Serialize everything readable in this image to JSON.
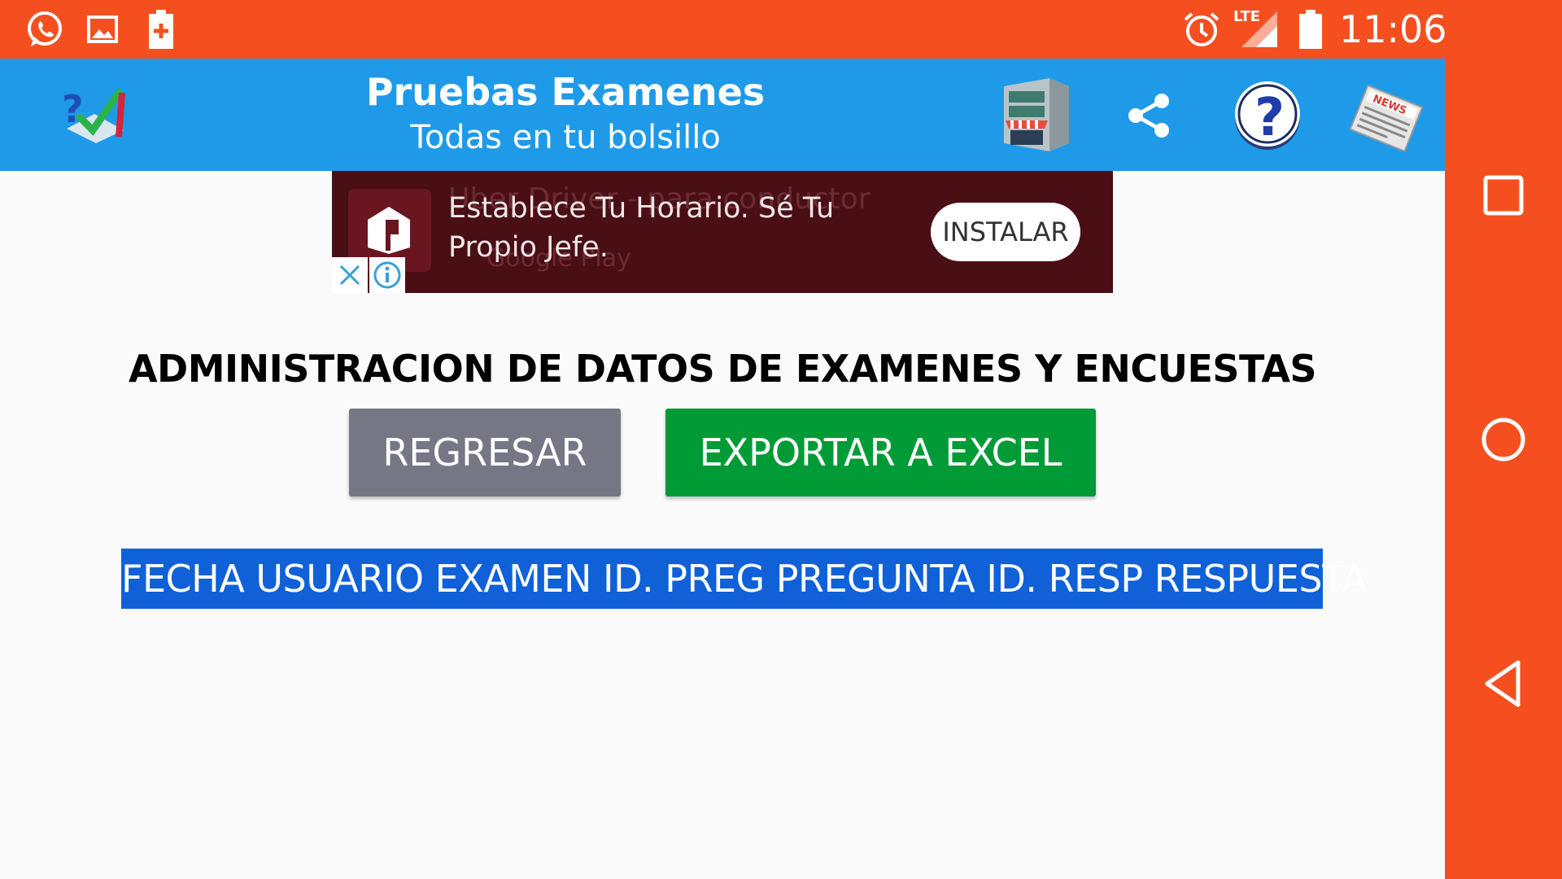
{
  "status_bar": {
    "time": "11:06",
    "network_label": "LTE",
    "icons": [
      "whatsapp-icon",
      "gallery-icon",
      "battery-saver-icon",
      "alarm-icon",
      "signal-icon",
      "battery-icon"
    ]
  },
  "toolbar": {
    "title": "Pruebas Examenes",
    "subtitle": "Todas en tu bolsillo",
    "icons": [
      "app-logo-icon",
      "store-icon",
      "share-icon",
      "help-icon",
      "news-icon"
    ],
    "news_label": "NEWS"
  },
  "ad": {
    "background_title": "Uber Driver - para conductor",
    "background_store": "Google Play",
    "text": "Establece Tu Horario. Sé Tu Propio Jefe.",
    "install_label": "INSTALAR"
  },
  "main": {
    "heading": "ADMINISTRACION DE DATOS DE EXAMENES Y ENCUESTAS",
    "back_button": "REGRESAR",
    "export_button": "EXPORTAR A EXCEL",
    "table_header": "FECHA USUARIO EXAMEN ID. PREG PREGUNTA ID. RESP RESPUESTA"
  },
  "colors": {
    "status_bar": "#F54F1F",
    "toolbar": "#1E9AE9",
    "back_button": "#767785",
    "export_button": "#009B37",
    "table_header": "#1061D8",
    "ad_background": "#4A0E15"
  },
  "nav_bar": {
    "icons": [
      "recent-apps-icon",
      "home-icon",
      "back-icon"
    ]
  }
}
